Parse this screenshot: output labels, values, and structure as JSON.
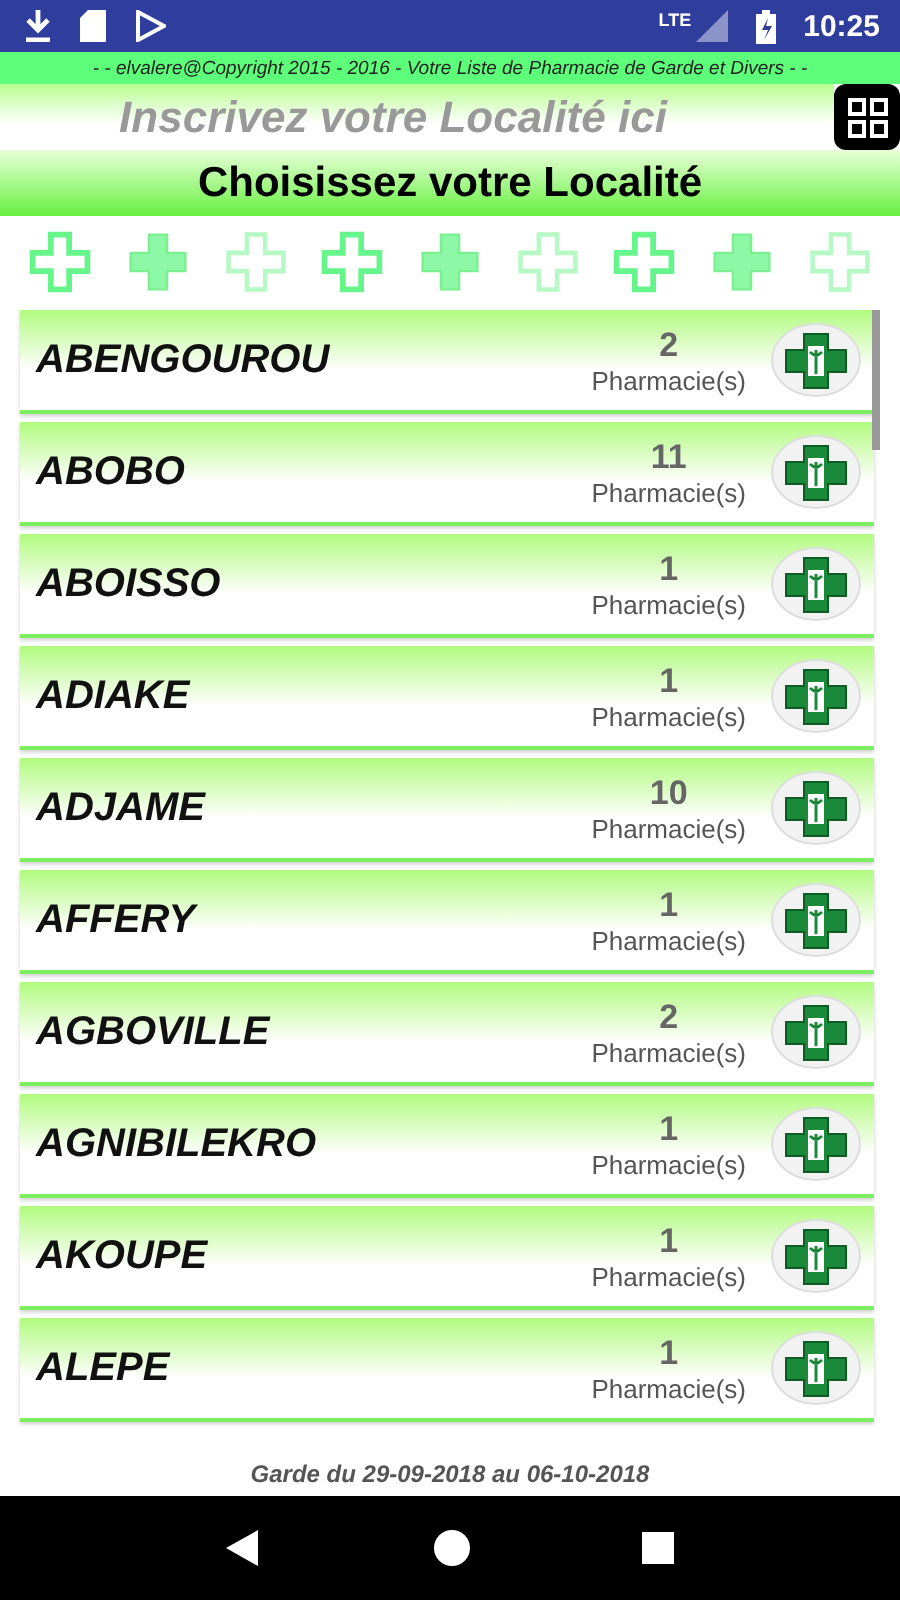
{
  "status_bar": {
    "network": "LTE",
    "time": "10:25"
  },
  "copyright": "- - elvalere@Copyright 2015 - 2016 - Votre Liste de Pharmacie de Garde et Divers - -",
  "search": {
    "placeholder": "Inscrivez votre Localité ici"
  },
  "title": "Choisissez votre Localité",
  "localities": [
    {
      "name": "ABENGOUROU",
      "count": "2",
      "unit": "Pharmacie(s)"
    },
    {
      "name": "ABOBO",
      "count": "11",
      "unit": "Pharmacie(s)"
    },
    {
      "name": "ABOISSO",
      "count": "1",
      "unit": "Pharmacie(s)"
    },
    {
      "name": "ADIAKE",
      "count": "1",
      "unit": "Pharmacie(s)"
    },
    {
      "name": "ADJAME",
      "count": "10",
      "unit": "Pharmacie(s)"
    },
    {
      "name": "AFFERY",
      "count": "1",
      "unit": "Pharmacie(s)"
    },
    {
      "name": "AGBOVILLE",
      "count": "2",
      "unit": "Pharmacie(s)"
    },
    {
      "name": "AGNIBILEKRO",
      "count": "1",
      "unit": "Pharmacie(s)"
    },
    {
      "name": "AKOUPE",
      "count": "1",
      "unit": "Pharmacie(s)"
    },
    {
      "name": "ALEPE",
      "count": "1",
      "unit": "Pharmacie(s)"
    }
  ],
  "footer": "Garde du 29-09-2018 au 06-10-2018"
}
